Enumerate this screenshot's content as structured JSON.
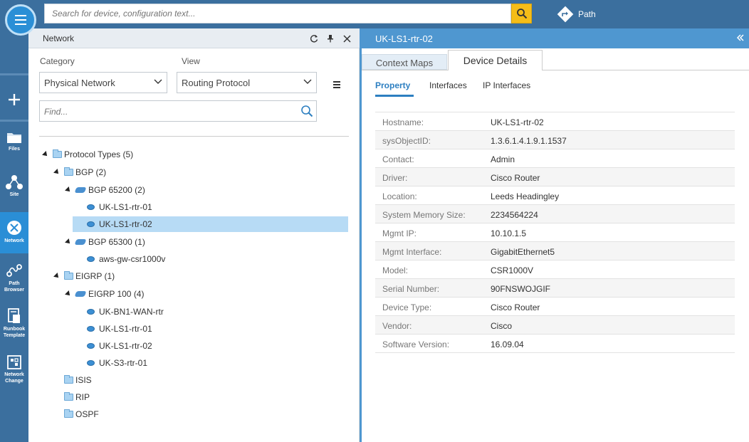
{
  "topbar": {
    "search_placeholder": "Search for device, configuration text...",
    "path_label": "Path"
  },
  "rail": {
    "items": [
      {
        "label1": "",
        "label2": ""
      },
      {
        "label1": "Files",
        "label2": ""
      },
      {
        "label1": "Site",
        "label2": ""
      },
      {
        "label1": "Network",
        "label2": ""
      },
      {
        "label1": "Path",
        "label2": "Browser"
      },
      {
        "label1": "Runbook",
        "label2": "Template"
      },
      {
        "label1": "Network",
        "label2": "Change"
      }
    ]
  },
  "panel": {
    "title": "Network",
    "category_label": "Category",
    "category_value": "Physical Network",
    "view_label": "View",
    "view_value": "Routing Protocol",
    "find_placeholder": "Find..."
  },
  "tree": [
    {
      "label": "Protocol Types (5)",
      "kind": "folder",
      "expanded": true
    },
    {
      "label": "BGP (2)",
      "kind": "folder",
      "expanded": true
    },
    {
      "label": "BGP 65200 (2)",
      "kind": "cloud",
      "expanded": true
    },
    {
      "label": "UK-LS1-rtr-01",
      "kind": "router"
    },
    {
      "label": "UK-LS1-rtr-02",
      "kind": "router",
      "selected": true
    },
    {
      "label": "BGP 65300 (1)",
      "kind": "cloud",
      "expanded": true
    },
    {
      "label": "aws-gw-csr1000v",
      "kind": "router"
    },
    {
      "label": "EIGRP (1)",
      "kind": "folder",
      "expanded": true
    },
    {
      "label": "EIGRP 100 (4)",
      "kind": "cloud",
      "expanded": true
    },
    {
      "label": "UK-BN1-WAN-rtr",
      "kind": "router"
    },
    {
      "label": "UK-LS1-rtr-01",
      "kind": "router"
    },
    {
      "label": "UK-LS1-rtr-02",
      "kind": "router"
    },
    {
      "label": "UK-S3-rtr-01",
      "kind": "router"
    },
    {
      "label": "ISIS",
      "kind": "folder"
    },
    {
      "label": "RIP",
      "kind": "folder"
    },
    {
      "label": "OSPF",
      "kind": "folder"
    }
  ],
  "detail": {
    "title": "UK-LS1-rtr-02",
    "tabs": [
      "Context Maps",
      "Device Details"
    ],
    "subtabs": [
      "Property",
      "Interfaces",
      "IP Interfaces"
    ],
    "properties": [
      {
        "key": "Hostname:",
        "value": "UK-LS1-rtr-02"
      },
      {
        "key": "sysObjectID:",
        "value": "1.3.6.1.4.1.9.1.1537"
      },
      {
        "key": "Contact:",
        "value": "Admin"
      },
      {
        "key": "Driver:",
        "value": "Cisco Router"
      },
      {
        "key": "Location:",
        "value": "Leeds Headingley"
      },
      {
        "key": "System Memory Size:",
        "value": "2234564224"
      },
      {
        "key": "Mgmt IP:",
        "value": "10.10.1.5"
      },
      {
        "key": "Mgmt Interface:",
        "value": "GigabitEthernet5"
      },
      {
        "key": "Model:",
        "value": "CSR1000V"
      },
      {
        "key": "Serial Number:",
        "value": "90FNSWOJGIF"
      },
      {
        "key": "Device Type:",
        "value": "Cisco Router"
      },
      {
        "key": "Vendor:",
        "value": "Cisco"
      },
      {
        "key": "Software Version:",
        "value": "16.09.04"
      }
    ]
  }
}
